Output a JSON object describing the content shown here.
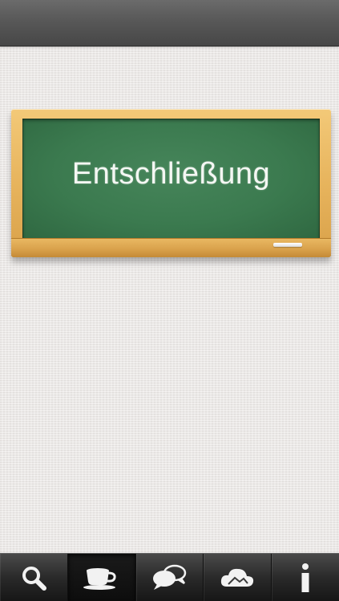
{
  "board": {
    "word": "Entschließung"
  },
  "tabs": [
    {
      "icon": "search-icon",
      "selected": false
    },
    {
      "icon": "coffee-cup-icon",
      "selected": true
    },
    {
      "icon": "chat-bubbles-icon",
      "selected": false
    },
    {
      "icon": "cloud-icon",
      "selected": false
    },
    {
      "icon": "info-icon",
      "selected": false
    }
  ],
  "colors": {
    "board_green": "#3b7a4f",
    "frame_wood": "#e7b45d",
    "tab_bar": "#2a2a2a",
    "icon": "#f2f2f2"
  }
}
